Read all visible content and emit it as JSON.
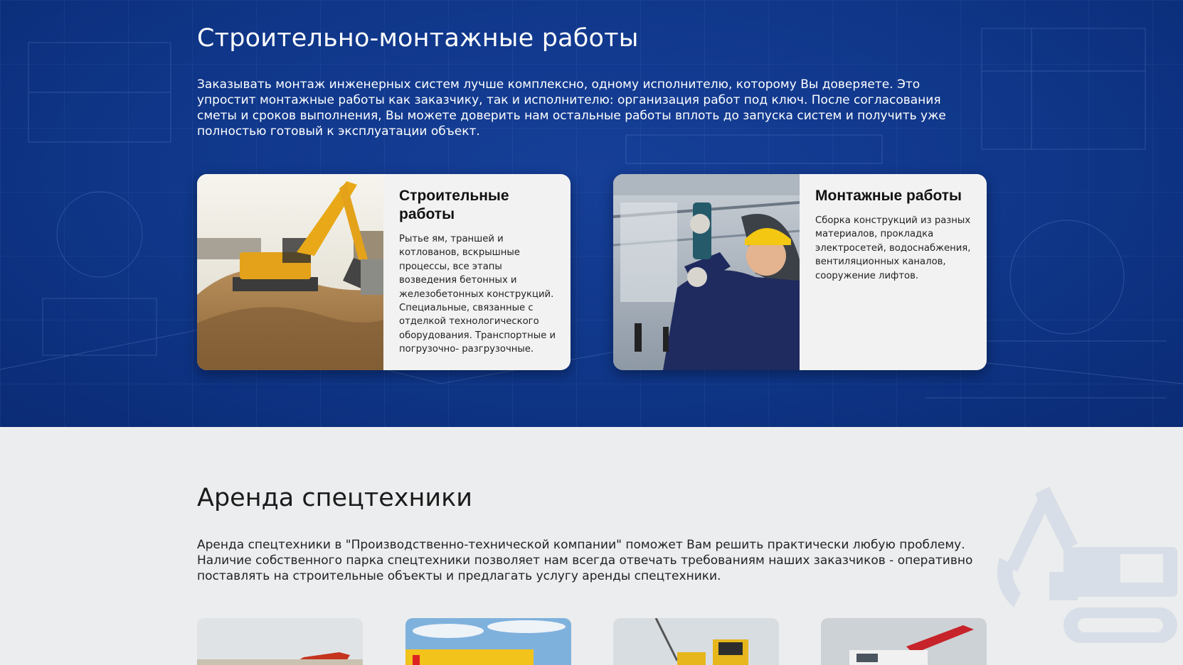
{
  "construction": {
    "title": "Строительно-монтажные работы",
    "intro": "Заказывать монтаж инженерных систем лучше комплексно, одному исполнителю, которому Вы доверяете. Это упростит монтажные работы как заказчику, так и исполнителю: организация работ под ключ. После согласования сметы и сроков выполнения, Вы можете доверить нам остальные работы вплоть до запуска систем и получить уже полностью готовый к эксплуатации объект.",
    "cards": [
      {
        "title": "Строительные работы",
        "text": "Рытье ям, траншей и котлованов, вскрышные процессы, все этапы возведения бетонных и железобетонных конструкций. Специальные, связанные с отделкой технологического оборудования. Транспортные и погрузочно- разгрузочные.",
        "image": "excavator-photo"
      },
      {
        "title": "Монтажные работы",
        "text": "Сборка конструкций из разных материалов, прокладка электросетей, водоснабжения, вентиляционных каналов, сооружение лифтов.",
        "image": "worker-drilling-photo"
      }
    ]
  },
  "rental": {
    "title": "Аренда спецтехники",
    "intro": "Аренда спецтехники в \"Производственно-технической компании\" поможет Вам решить практически любую проблему. Наличие собственного парка спецтехники позволяет нам всегда отвечать требованиям наших заказчиков - оперативно поставлять на строительные объекты и предлагать услугу аренды спецтехники.",
    "thumbnails": [
      "red-excavator-photo",
      "yellow-crane-photo",
      "loaders-photo",
      "crane-truck-photo"
    ]
  },
  "colors": {
    "section_blue": "#0f3688",
    "section_grey": "#ecedee",
    "card_bg": "#f2f2f2"
  }
}
